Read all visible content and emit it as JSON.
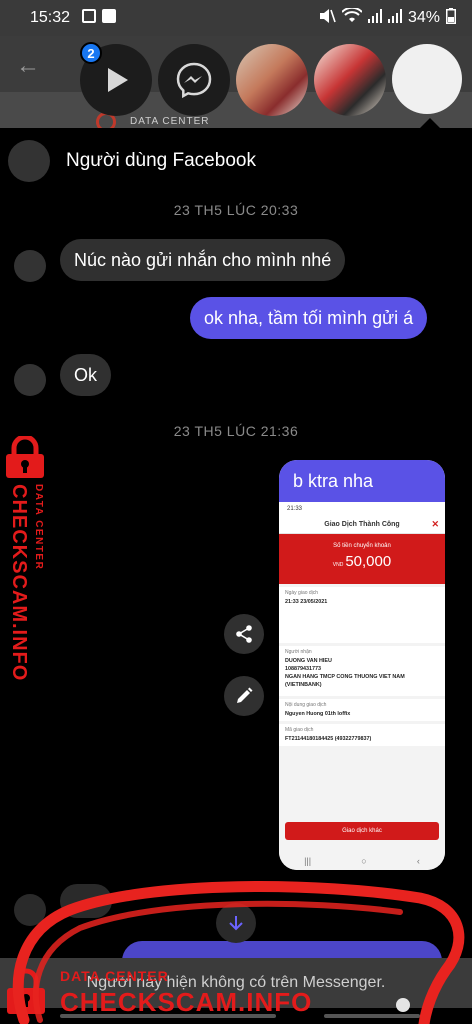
{
  "status_bar": {
    "time": "15:32",
    "battery": "34%",
    "icons": [
      "image-icon",
      "download-check-icon",
      "mute-icon",
      "wifi-icon",
      "signal-icon",
      "signal-icon",
      "battery-icon"
    ]
  },
  "chat_heads": {
    "badge_count": "2",
    "items": [
      "play-icon",
      "messenger-icon",
      "contact-avatar-1",
      "contact-avatar-2",
      "active-chat-avatar"
    ]
  },
  "background_watermark": {
    "text": "DATA CENTER"
  },
  "chat": {
    "contact_name": "Người dùng Facebook",
    "messages": [
      {
        "type": "timestamp",
        "text": "23 TH5 LÚC 20:33"
      },
      {
        "type": "incoming",
        "text": "Núc nào gửi nhắn cho mình nhé"
      },
      {
        "type": "outgoing",
        "text": "ok nha, tầm tối mình gửi á"
      },
      {
        "type": "incoming",
        "text": "Ok"
      },
      {
        "type": "timestamp",
        "text": "23 TH5 LÚC 21:36"
      },
      {
        "type": "outgoing-image",
        "caption": "b ktra nha"
      }
    ]
  },
  "receipt": {
    "time": "21:33",
    "title": "Giao Dịch Thành Công",
    "amount_label": "Số tiền chuyển khoản",
    "currency": "VND",
    "amount": "50,000",
    "date_label": "Ngày giao dịch",
    "date": "21:33 23/05/2021",
    "recipient_label": "Người nhận",
    "recipient_name": "DUONG VAN HIEU",
    "recipient_account": "108879431773",
    "recipient_bank": "NGAN HANG TMCP CONG THUONG VIET NAM (VIETINBANK)",
    "content_label": "Nội dung giao dịch",
    "content": "Nguyen Huong 01th loffix",
    "code_label": "Mã giao dịch",
    "code": "FT21144180184425 (49322779837)",
    "button": "Giao dịch khác",
    "nav": [
      "|||",
      "○",
      "‹"
    ]
  },
  "actions": {
    "share": "share-icon",
    "edit": "edit-icon",
    "scroll_down": "arrow-down-icon"
  },
  "notice": "Người này hiện không có trên Messenger.",
  "watermark": {
    "brand": "CHECKSCAM.INFO",
    "sub": "DATA CENTER",
    "color": "#e31b1b"
  },
  "colors": {
    "outgoing_bubble": "#5a52e6",
    "incoming_bubble": "#303030",
    "receipt_red": "#d11a1a",
    "badge": "#1877f2"
  }
}
